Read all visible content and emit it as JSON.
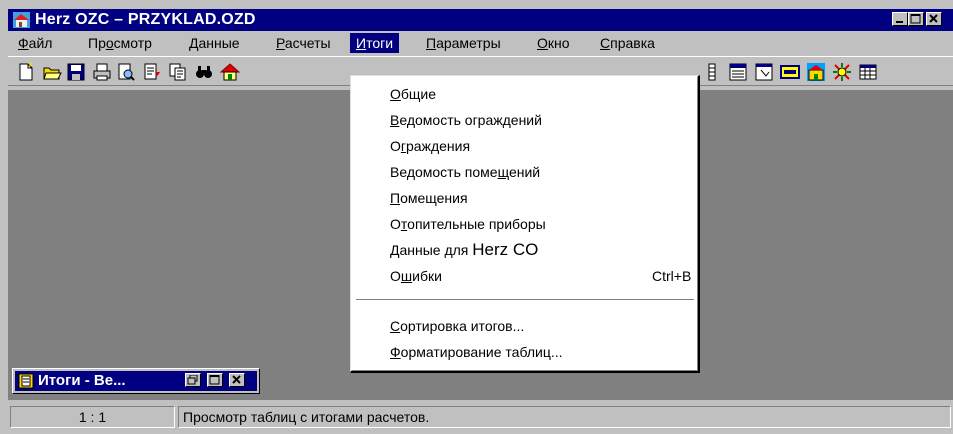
{
  "window": {
    "title": "Herz OZC – PRZYKLAD.OZD"
  },
  "menubar": {
    "items": [
      {
        "pre": "",
        "acc": "Ф",
        "post": "айл"
      },
      {
        "pre": "Пр",
        "acc": "о",
        "post": "смотр"
      },
      {
        "pre": "",
        "acc": "Д",
        "post": "анные"
      },
      {
        "pre": "",
        "acc": "Р",
        "post": "асчеты"
      },
      {
        "pre": "",
        "acc": "И",
        "post": "тоги"
      },
      {
        "pre": "",
        "acc": "П",
        "post": "араметры"
      },
      {
        "pre": "",
        "acc": "О",
        "post": "кно"
      },
      {
        "pre": "",
        "acc": "С",
        "post": "правка"
      }
    ]
  },
  "toolbar": {
    "icons": [
      "new-file-icon",
      "open-folder-icon",
      "save-icon",
      "print-icon",
      "print-preview-icon",
      "import-icon",
      "copy-icon",
      "find-icon",
      "house-icon",
      "results-grid-icon",
      "export-icon",
      "window-icon",
      "component-icon",
      "building-icon",
      "settings-icon",
      "table-icon"
    ]
  },
  "menu_itogi": {
    "items": [
      {
        "pre": "",
        "acc": "О",
        "post": "бщие",
        "shortcut": ""
      },
      {
        "pre": "",
        "acc": "В",
        "post": "едомость ограждений",
        "shortcut": ""
      },
      {
        "pre": "О",
        "acc": "г",
        "post": "раждения",
        "shortcut": ""
      },
      {
        "pre": "Ведомость поме",
        "acc": "щ",
        "post": "ений",
        "shortcut": ""
      },
      {
        "pre": "",
        "acc": "П",
        "post": "омещения",
        "shortcut": ""
      },
      {
        "pre": "О",
        "acc": "т",
        "post": "опительные приборы",
        "shortcut": ""
      },
      {
        "pre": "",
        "acc": "Д",
        "post": "анные для ",
        "extra": "Herz CO",
        "shortcut": ""
      },
      {
        "pre": "О",
        "acc": "ш",
        "post": "ибки",
        "shortcut": "Ctrl+B"
      },
      {
        "pre": "",
        "acc": "С",
        "post": "ортировка итогов...",
        "shortcut": ""
      },
      {
        "pre": "",
        "acc": "Ф",
        "post": "орматирование таблиц...",
        "shortcut": ""
      }
    ]
  },
  "minimized_window": {
    "title": "Итоги - Ве..."
  },
  "statusbar": {
    "position": "1 : 1",
    "message": "Просмотр таблиц с итогами расчетов."
  },
  "colors": {
    "titlebar": "#000080",
    "face": "#c0c0c0",
    "mdi": "#808080"
  }
}
